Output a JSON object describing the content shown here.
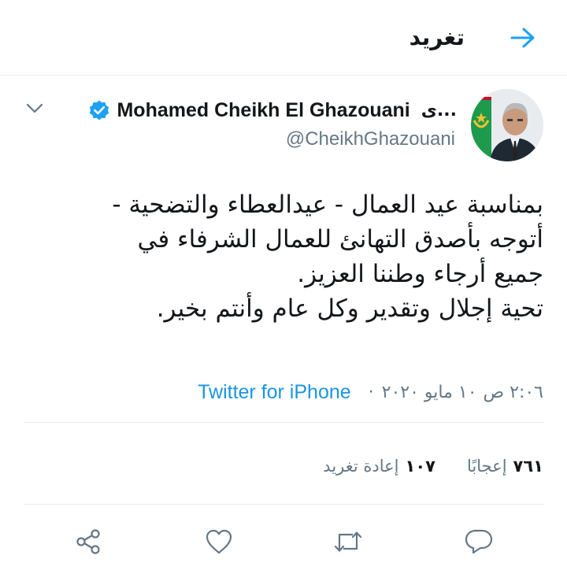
{
  "header": {
    "title": "تغريد",
    "back_icon": "arrow-right-icon"
  },
  "tweet": {
    "display_name": "Mohamed Cheikh El Ghazouani",
    "name_prefix": "...ى",
    "handle": "@CheikhGhazouani",
    "verified": true,
    "text_lines": [
      "بمناسبة عيد العمال - عيدالعطاء والتضحية -",
      "أتوجه بأصدق التهانئ للعمال الشرفاء في",
      "جميع أرجاء وطننا العزيز.",
      "تحية إجلال وتقدير وكل عام وأنتم بخير."
    ],
    "time": "٢:٠٦ ص",
    "date": "١٠ مايو ٢٠٢٠",
    "separator": "·",
    "source": "Twitter for iPhone"
  },
  "stats": {
    "retweets_count": "١٠٧",
    "retweets_label": "إعادة تغريد",
    "likes_count": "٧٦١",
    "likes_label": "إعجابًا"
  },
  "actions": [
    "reply-icon",
    "retweet-icon",
    "like-icon",
    "share-icon"
  ],
  "colors": {
    "accent": "#1da1f2",
    "source_link": "#1b95e0",
    "secondary_text": "#657786",
    "divider": "#e6ecf0"
  }
}
